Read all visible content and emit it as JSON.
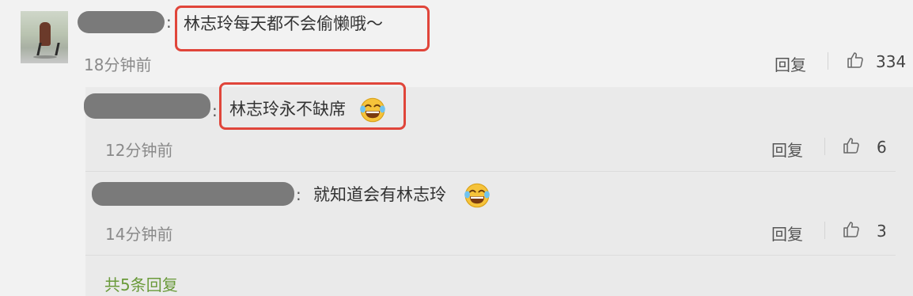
{
  "comment": {
    "text": "林志玲每天都不会偷懒哦～",
    "time": "18分钟前",
    "reply_label": "回复",
    "likes": "334"
  },
  "replies": [
    {
      "text": "林志玲永不缺席",
      "emoji": "laugh-cry-emoji",
      "time": "12分钟前",
      "reply_label": "回复",
      "likes": "6"
    },
    {
      "text": "就知道会有林志玲",
      "emoji": "laugh-cry-emoji",
      "time": "14分钟前",
      "reply_label": "回复",
      "likes": "3"
    }
  ],
  "more_replies": "共5条回复",
  "colors": {
    "highlight": "#e0453a",
    "more_link": "#6a9a3a"
  },
  "icons": [
    "thumbs-up-icon",
    "laugh-cry-emoji"
  ]
}
